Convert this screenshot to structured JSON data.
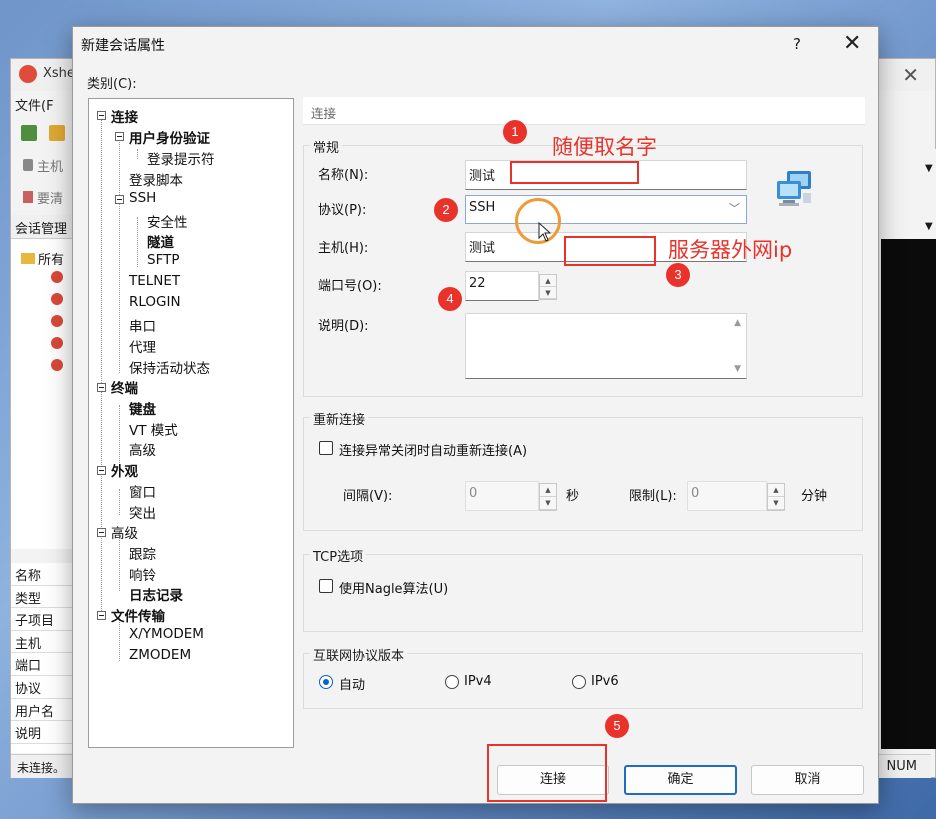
{
  "background_window": {
    "title": "Xshe",
    "menu": [
      "文件(F"
    ],
    "address_labels": [
      "主机",
      "要清"
    ],
    "session_manager_label": "会话管理",
    "tree_root": "所有",
    "props_rows": [
      "名称",
      "类型",
      "子项目",
      "主机",
      "端口",
      "协议",
      "用户名",
      "说明"
    ],
    "status_left": "未连接。",
    "status_right": "NUM"
  },
  "dialog": {
    "title": "新建会话属性",
    "help": "?",
    "close": "✕",
    "category_label": "类别(C):",
    "breadcrumb": "连接"
  },
  "tree": [
    {
      "label": "连接",
      "bold": true
    },
    {
      "label": "用户身份验证",
      "bold": true
    },
    {
      "label": "登录提示符",
      "bold": false
    },
    {
      "label": "登录脚本",
      "bold": false
    },
    {
      "label": "SSH",
      "bold": false
    },
    {
      "label": "安全性",
      "bold": false
    },
    {
      "label": "隧道",
      "bold": true
    },
    {
      "label": "SFTP",
      "bold": false
    },
    {
      "label": "TELNET",
      "bold": false
    },
    {
      "label": "RLOGIN",
      "bold": false
    },
    {
      "label": "串口",
      "bold": false
    },
    {
      "label": "代理",
      "bold": false
    },
    {
      "label": "保持活动状态",
      "bold": false
    },
    {
      "label": "终端",
      "bold": true
    },
    {
      "label": "键盘",
      "bold": true
    },
    {
      "label": "VT 模式",
      "bold": false
    },
    {
      "label": "高级",
      "bold": false
    },
    {
      "label": "外观",
      "bold": true
    },
    {
      "label": "窗口",
      "bold": false
    },
    {
      "label": "突出",
      "bold": false
    },
    {
      "label": "高级",
      "bold": false
    },
    {
      "label": "跟踪",
      "bold": false
    },
    {
      "label": "响铃",
      "bold": false
    },
    {
      "label": "日志记录",
      "bold": true
    },
    {
      "label": "文件传输",
      "bold": true
    },
    {
      "label": "X/YMODEM",
      "bold": false
    },
    {
      "label": "ZMODEM",
      "bold": false
    }
  ],
  "general": {
    "group_title": "常规",
    "name_label": "名称(N):",
    "name_value": "测试",
    "protocol_label": "协议(P):",
    "protocol_value": "SSH",
    "host_label": "主机(H):",
    "host_value": "测试",
    "port_label": "端口号(O):",
    "port_value": "22",
    "desc_label": "说明(D):"
  },
  "reconnect": {
    "group_title": "重新连接",
    "checkbox_label": "连接异常关闭时自动重新连接(A)",
    "interval_label": "间隔(V):",
    "interval_value": "0",
    "interval_unit": "秒",
    "limit_label": "限制(L):",
    "limit_value": "0",
    "limit_unit": "分钟"
  },
  "tcp": {
    "group_title": "TCP选项",
    "checkbox_label": "使用Nagle算法(U)"
  },
  "ip": {
    "group_title": "互联网协议版本",
    "options": [
      "自动",
      "IPv4",
      "IPv6"
    ],
    "selected": "自动"
  },
  "buttons": {
    "connect": "连接",
    "ok": "确定",
    "cancel": "取消"
  },
  "annotations": {
    "markers": [
      "1",
      "2",
      "3",
      "4",
      "5"
    ],
    "name_hint": "随便取名字",
    "host_hint": "服务器外网ip",
    "color": "#e8322a"
  }
}
